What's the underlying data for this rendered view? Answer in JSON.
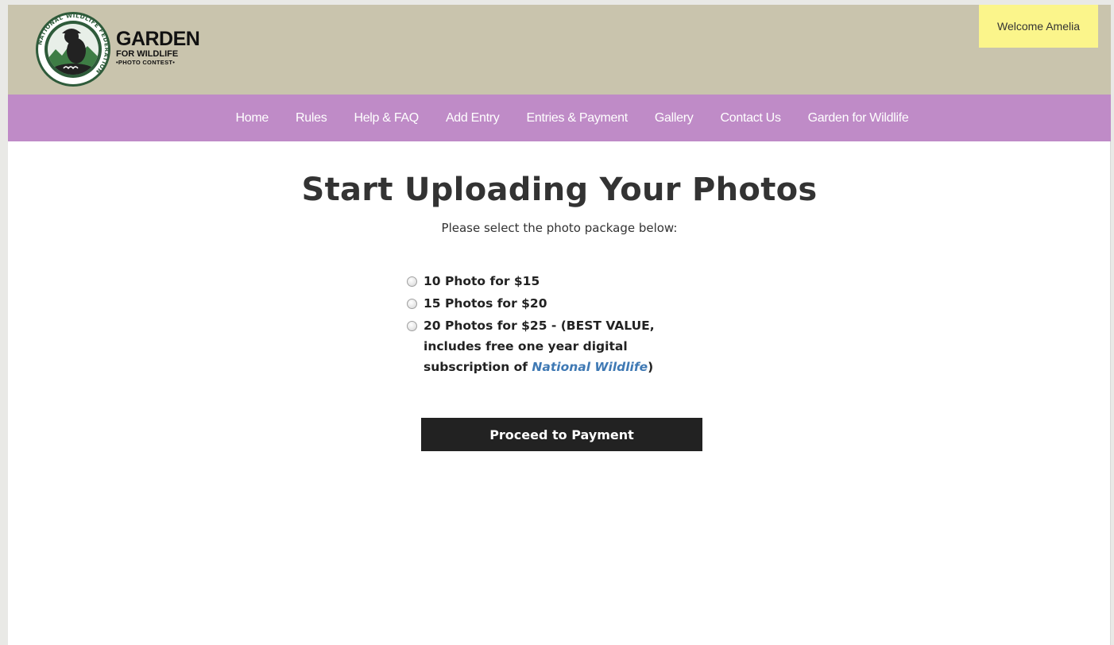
{
  "header": {
    "logo": {
      "ring_text": "NATIONAL WILDLIFE FEDERATION",
      "title": "GARDEN",
      "subtitle": "FOR WILDLIFE",
      "tagline": "•PHOTO CONTEST•"
    },
    "welcome": "Welcome Amelia"
  },
  "nav": {
    "items": [
      {
        "label": "Home"
      },
      {
        "label": "Rules"
      },
      {
        "label": "Help & FAQ"
      },
      {
        "label": "Add Entry"
      },
      {
        "label": "Entries & Payment"
      },
      {
        "label": "Gallery"
      },
      {
        "label": "Contact Us"
      },
      {
        "label": "Garden for Wildlife"
      }
    ]
  },
  "main": {
    "title": "Start Uploading Your Photos",
    "subtitle": "Please select the photo package below:",
    "packages": [
      {
        "label": "10 Photo for $15"
      },
      {
        "label": "15 Photos for $20"
      },
      {
        "label_before": "20 Photos for $25 - (BEST VALUE, includes free one year digital subscription of ",
        "label_magazine": "National Wildlife",
        "label_after": ")"
      }
    ],
    "proceed_label": "Proceed to Payment"
  },
  "colors": {
    "header_bg": "#c9c4ad",
    "nav_bg": "#bf8bc7",
    "welcome_bg": "#fbf58b",
    "button_bg": "#222222",
    "link": "#3f79b4"
  }
}
